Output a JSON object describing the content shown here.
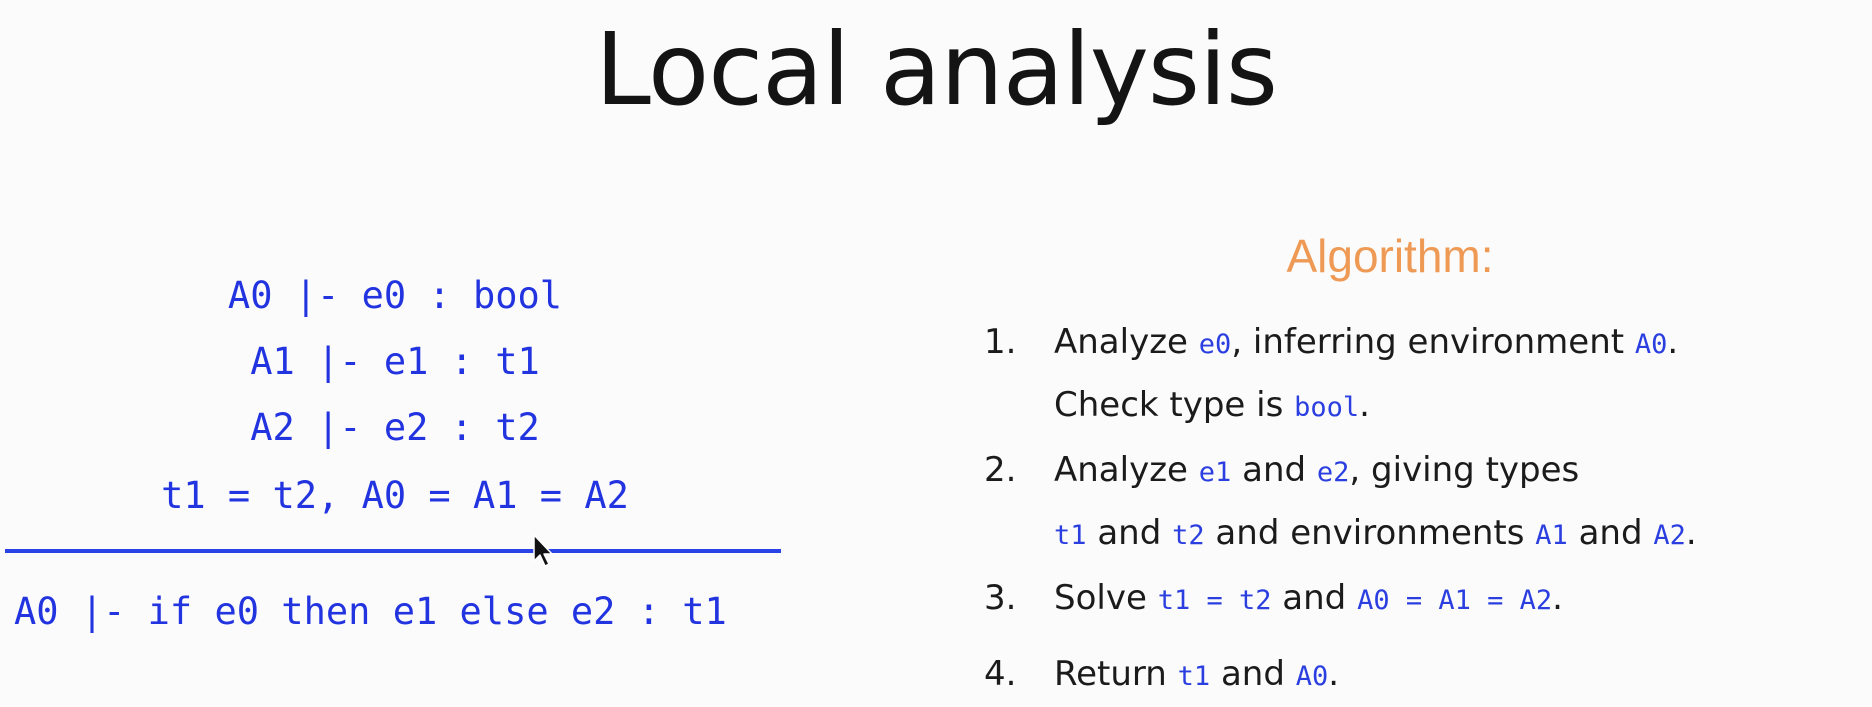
{
  "slide": {
    "title": "Local analysis"
  },
  "rule": {
    "premises": [
      "A0 |- e0 : bool",
      "A1 |- e1 : t1",
      "A2 |- e2 : t2",
      "t1 = t2, A0 = A1 = A2"
    ],
    "conclusion": "A0 |- if e0 then e1 else e2 : t1"
  },
  "algorithm": {
    "heading": "Algorithm:",
    "steps": [
      {
        "number": "1.",
        "line1": {
          "t1": "Analyze ",
          "c1": "e0",
          "t2": ", inferring environment ",
          "c2": "A0",
          "t3": "."
        },
        "line2": {
          "t1": "Check type is ",
          "c1": "bool",
          "t2": "."
        }
      },
      {
        "number": "2.",
        "line1": {
          "t1": "Analyze ",
          "c1": "e1",
          "t2": " and ",
          "c2": "e2",
          "t3": ", giving types"
        },
        "line2": {
          "c1": "t1",
          "t1": " and ",
          "c2": "t2",
          "t2": " and environments ",
          "c3": "A1",
          "t3": " and ",
          "c4": "A2",
          "t4": "."
        }
      },
      {
        "number": "3.",
        "line1": {
          "t1": "Solve ",
          "c1": "t1 = t2",
          "t2": " and ",
          "c2": "A0 = A1 = A2",
          "t3": "."
        }
      },
      {
        "number": "4.",
        "line1": {
          "t1": "Return ",
          "c1": "t1",
          "t2": " and ",
          "c2": "A0",
          "t3": "."
        }
      }
    ]
  },
  "colors": {
    "code_blue": "#2b3fe0",
    "heading_orange": "#ee9a55",
    "text": "#1b1b1b"
  },
  "icons": {
    "cursor": "mouse-pointer-icon"
  }
}
